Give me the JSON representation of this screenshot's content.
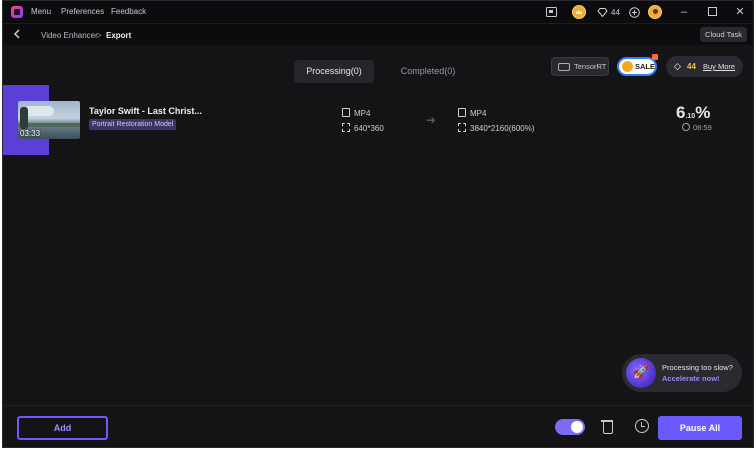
{
  "titlebar": {
    "menus": [
      "Menu",
      "Preferences",
      "Feedback"
    ],
    "credits": "44",
    "icons": [
      "app-logo",
      "screen-record-icon",
      "crown-coin-icon",
      "diamond-icon",
      "add-circle-icon",
      "user-avatar-icon",
      "minimize-icon",
      "maximize-icon",
      "close-icon"
    ]
  },
  "navbar": {
    "crumb_parent": "Video Enhancer",
    "crumb_sep": ">",
    "crumb_current": "Export",
    "cloud_task": "Cloud Task"
  },
  "tabs": {
    "processing": "Processing(0)",
    "completed": "Completed(0)"
  },
  "promo": {
    "tensorrt": "TensorRT",
    "sale": "SALE",
    "gem_count": "44",
    "buy_more": "Buy More"
  },
  "task": {
    "title": "Taylor Swift - Last Christ...",
    "model": "Portrait Restoration Model",
    "duration": "03:33",
    "src_format": "MP4",
    "src_resolution": "640*360",
    "dst_format": "MP4",
    "dst_resolution": "3840*2160(600%)",
    "progress_int": "6",
    "progress_frac": ".10",
    "progress_unit": "%",
    "time_left": "08:59"
  },
  "accelerate": {
    "question": "Processing too slow?",
    "link": "Accelerate now!"
  },
  "footer": {
    "add": "Add",
    "pause_all": "Pause All"
  },
  "colors": {
    "accent": "#6b5bff",
    "background": "#141417",
    "titlebar": "#0c0c0e"
  }
}
